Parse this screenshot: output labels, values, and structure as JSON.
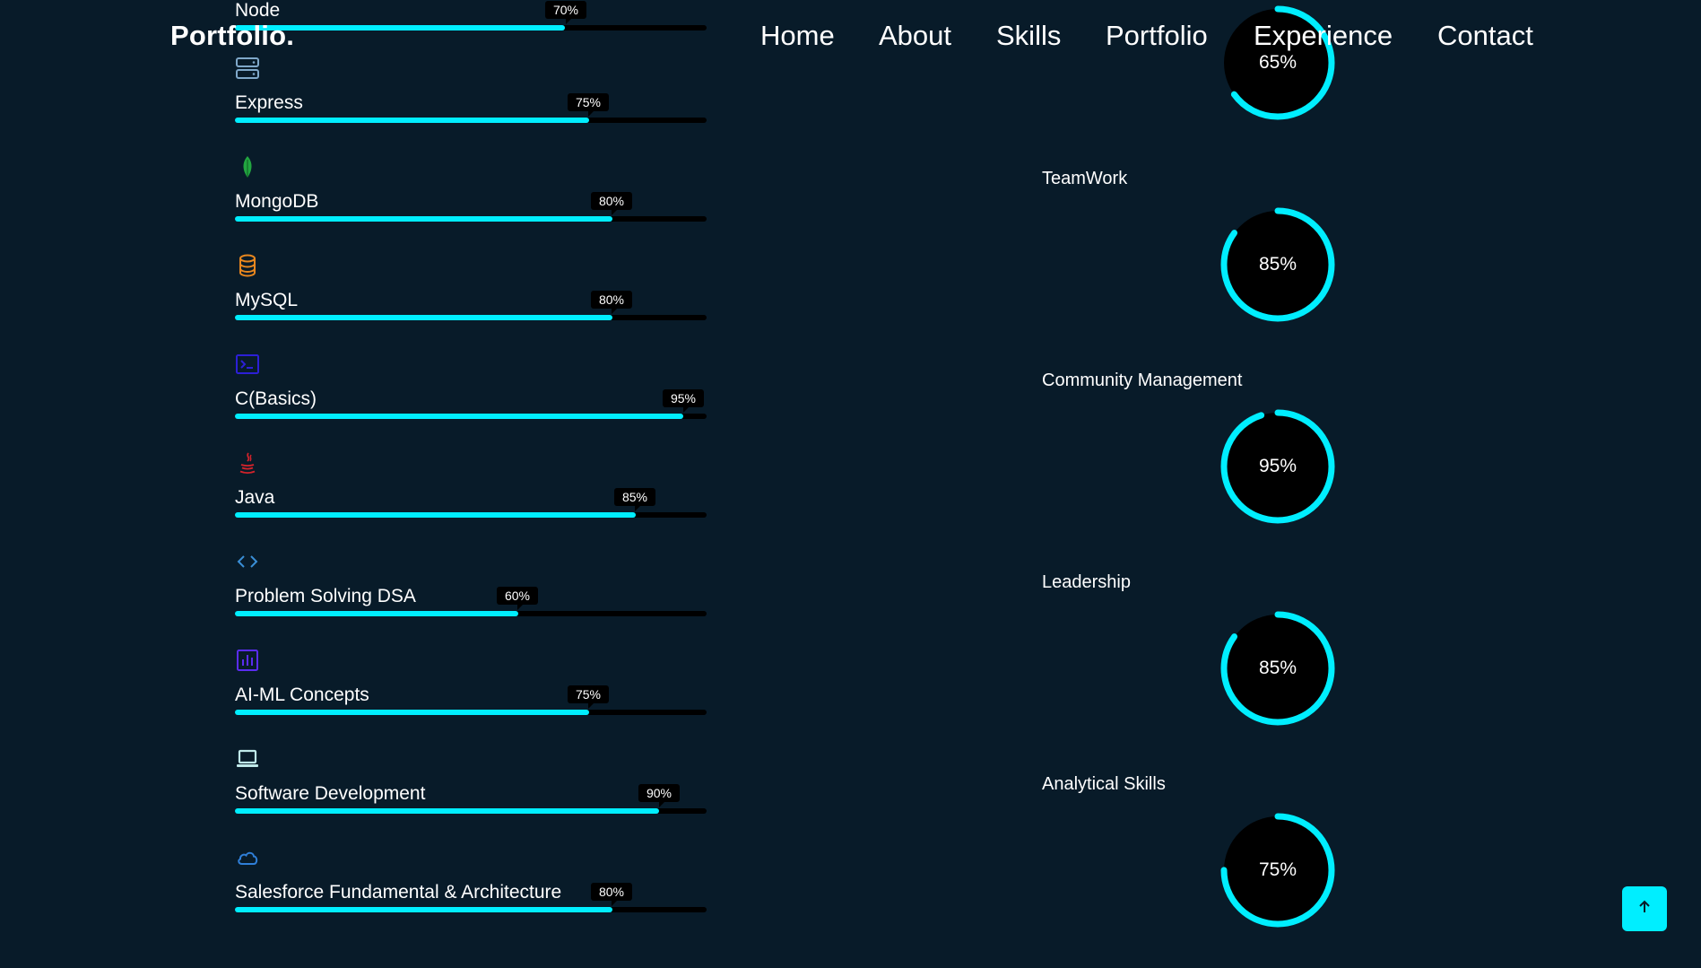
{
  "header": {
    "logo": "Portfolio.",
    "nav": [
      "Home",
      "About",
      "Skills",
      "Portfolio",
      "Experience",
      "Contact"
    ]
  },
  "technical_skills": [
    {
      "name": "Node",
      "percent_label": "70%",
      "percent": 70,
      "icon": "node-icon",
      "icon_color": "#00eeff"
    },
    {
      "name": "Express",
      "percent_label": "75%",
      "percent": 75,
      "icon": "server-icon",
      "icon_color": "#7fa8c9"
    },
    {
      "name": "MongoDB",
      "percent_label": "80%",
      "percent": 80,
      "icon": "mongodb-leaf-icon",
      "icon_color": "#22a640"
    },
    {
      "name": "MySQL",
      "percent_label": "80%",
      "percent": 80,
      "icon": "database-icon",
      "icon_color": "#e8871e"
    },
    {
      "name": "C(Basics)",
      "percent_label": "95%",
      "percent": 95,
      "icon": "terminal-icon",
      "icon_color": "#2c1fd6"
    },
    {
      "name": "Java",
      "percent_label": "85%",
      "percent": 85,
      "icon": "java-icon",
      "icon_color": "#d3232b"
    },
    {
      "name": "Problem Solving DSA",
      "percent_label": "60%",
      "percent": 60,
      "icon": "code-icon",
      "icon_color": "#3a8fd6"
    },
    {
      "name": "AI-ML Concepts",
      "percent_label": "75%",
      "percent": 75,
      "icon": "chart-icon",
      "icon_color": "#5a2cf0"
    },
    {
      "name": "Software Development",
      "percent_label": "90%",
      "percent": 90,
      "icon": "laptop-icon",
      "icon_color": "#bfe9e9"
    },
    {
      "name": "Salesforce Fundamental & Architecture",
      "percent_label": "80%",
      "percent": 80,
      "icon": "cloud-icon",
      "icon_color": "#2f7fd8"
    }
  ],
  "professional_skills": [
    {
      "name": "",
      "percent_label": "65%",
      "percent": 65
    },
    {
      "name": "TeamWork",
      "percent_label": "85%",
      "percent": 85
    },
    {
      "name": "Community Management",
      "percent_label": "95%",
      "percent": 95
    },
    {
      "name": "Leadership",
      "percent_label": "85%",
      "percent": 85
    },
    {
      "name": "Analytical Skills",
      "percent_label": "75%",
      "percent": 75
    }
  ],
  "accent_color": "#00eeff",
  "background_color": "#081b29",
  "scroll_top_icon": "arrow-up-icon"
}
